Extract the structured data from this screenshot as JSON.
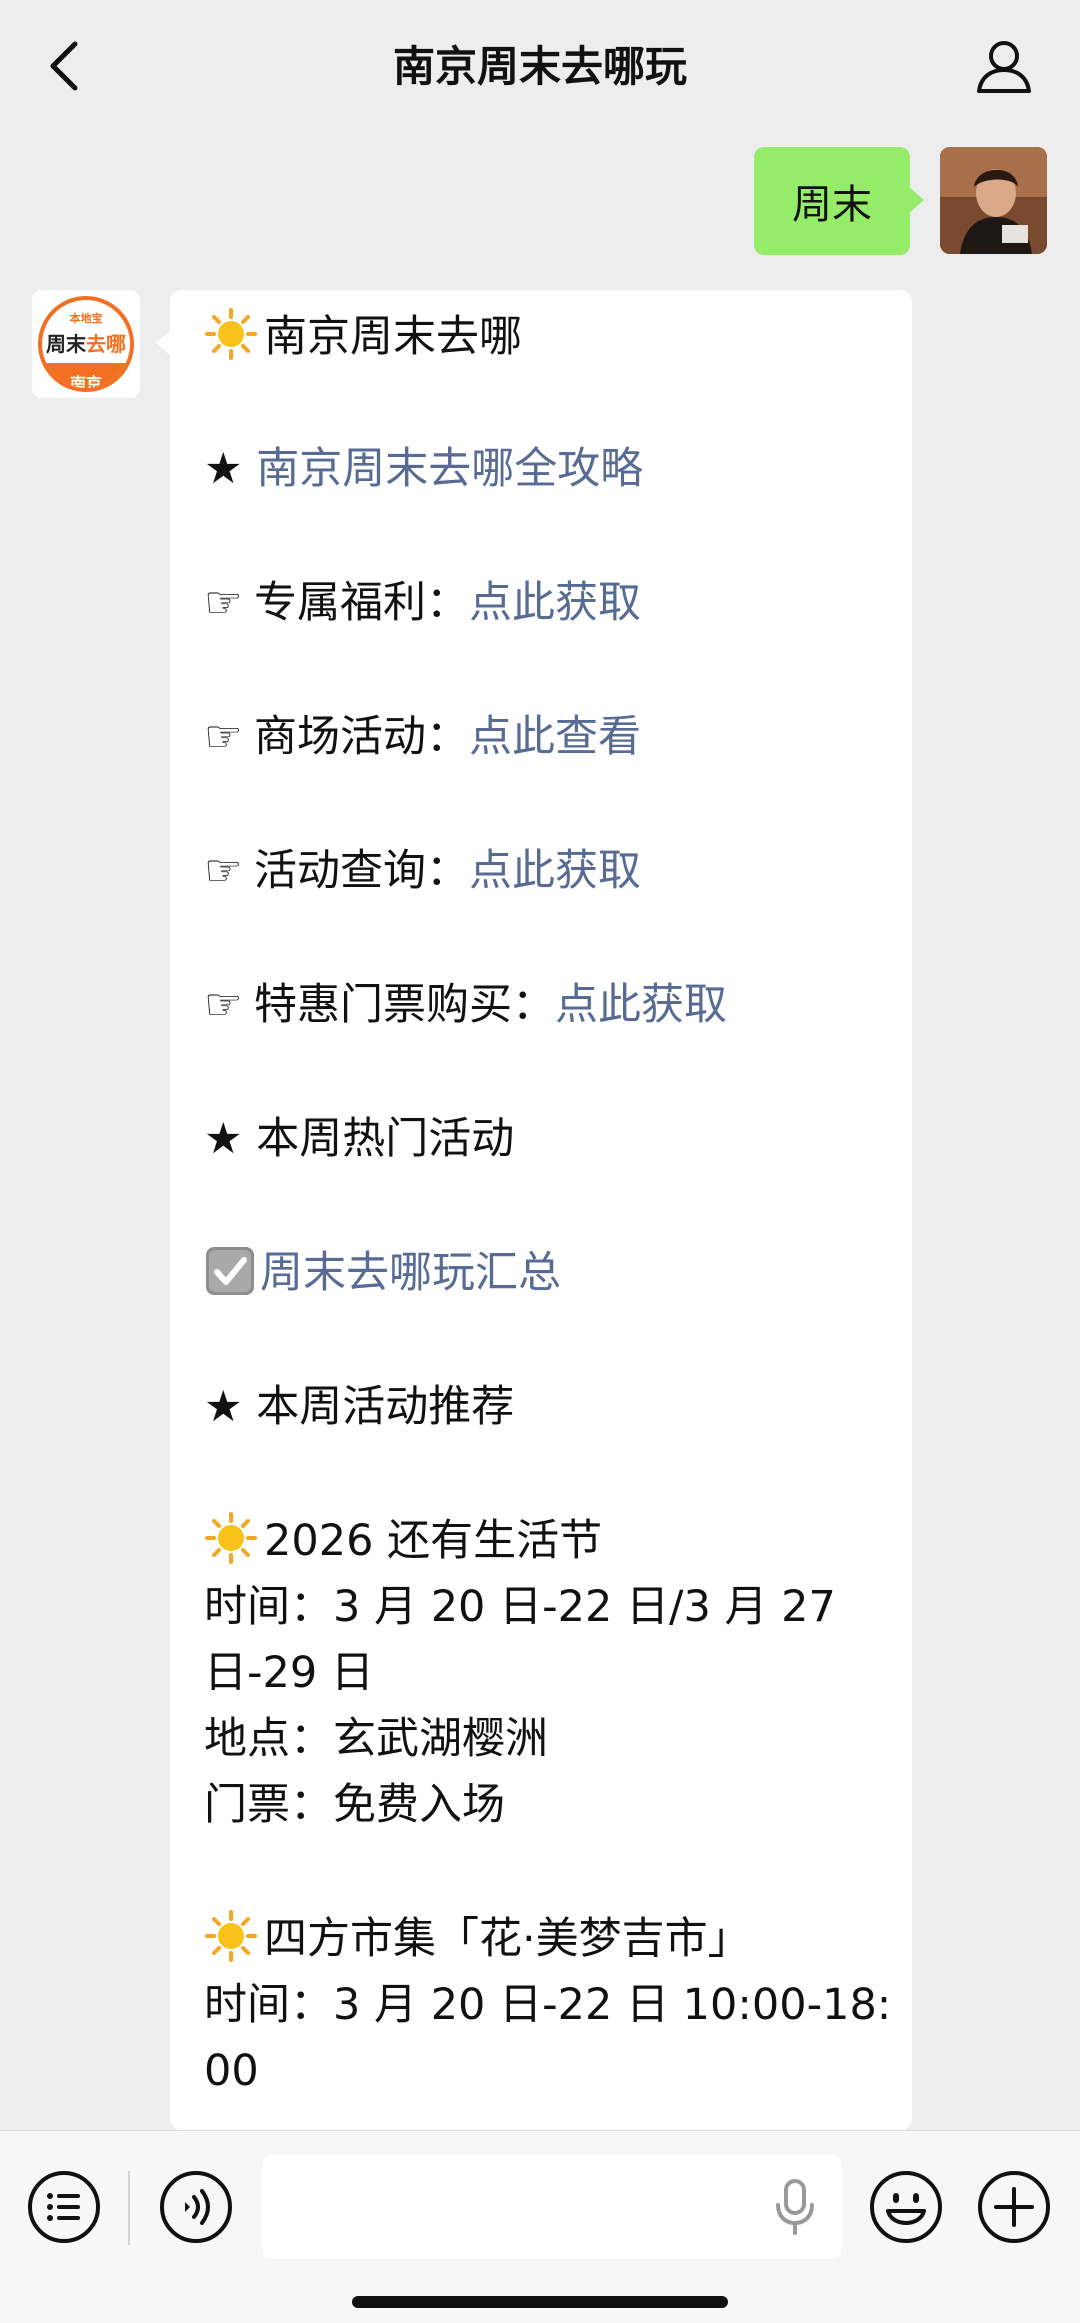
{
  "header": {
    "title": "南京周末去哪玩",
    "back_icon": "chevron-left-icon",
    "profile_icon": "person-icon"
  },
  "user_message": {
    "text": "周末",
    "bubble_color": "#95ec69"
  },
  "bot_avatar": {
    "logo_top": "本地宝",
    "logo_main_a": "周末",
    "logo_main_b": "去哪",
    "logo_bottom": "南京",
    "accent": "#f36f21"
  },
  "bot_message": {
    "line_sun_title": "南京周末去哪",
    "star1_prefix": "★ ",
    "star1_link": "南京周末去哪全攻略",
    "item1_label": "专属福利：",
    "item1_link": "点此获取",
    "item2_label": "商场活动：",
    "item2_link": "点此查看",
    "item3_label": "活动查询：",
    "item3_link": "点此获取",
    "item4_label": "特惠门票购买：",
    "item4_link": "点此获取",
    "hand_glyph": "☞",
    "star2": "★ 本周热门活动",
    "check_link": "周末去哪玩汇总",
    "star3": "★ 本周活动推荐",
    "event1": {
      "title": "2026 还有生活节",
      "time_line1": "时间：3 月 20 日-22 日/3 月 27",
      "time_line2": "日-29 日",
      "place": "地点：玄武湖樱洲",
      "ticket": "门票：免费入场"
    },
    "event2": {
      "title": "四方市集「花·美梦吉市」",
      "time_line1": "时间：3 月 20 日-22 日 10:00-18:",
      "time_line2": "00"
    },
    "link_color": "#576b95"
  },
  "input_bar": {
    "placeholder": "",
    "menu_icon": "menu-list-icon",
    "voice_icon": "voice-icon",
    "mic_icon": "microphone-icon",
    "emoji_icon": "emoji-icon",
    "plus_icon": "plus-icon"
  }
}
